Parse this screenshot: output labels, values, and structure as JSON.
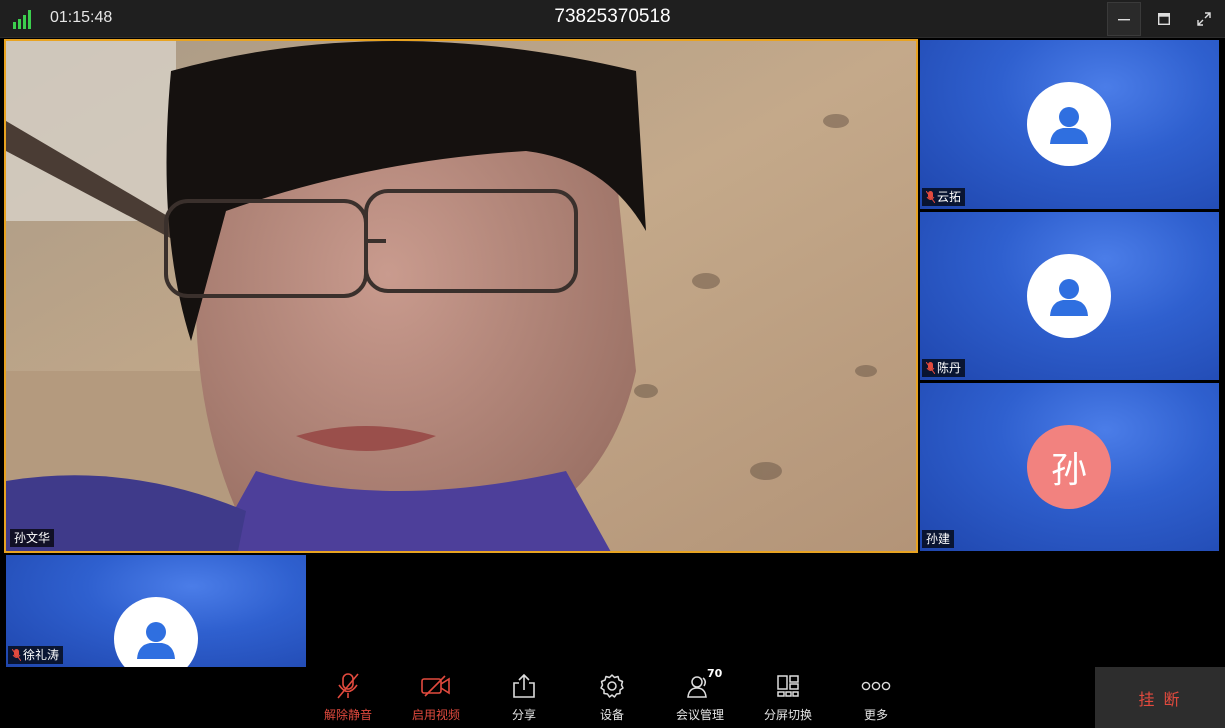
{
  "header": {
    "elapsed_time": "01:15:48",
    "meeting_id": "73825370518"
  },
  "main_video": {
    "participant_name": "孙文华"
  },
  "participants": [
    {
      "name": "云拓",
      "muted": true,
      "avatar": "person-icon"
    },
    {
      "name": "陈丹",
      "muted": true,
      "avatar": "person-icon"
    },
    {
      "name": "孙建",
      "muted": false,
      "avatar_letter": "孙"
    },
    {
      "name": "徐礼涛",
      "muted": true,
      "avatar": "person-icon"
    }
  ],
  "toolbar": {
    "unmute_label": "解除静音",
    "start_video_label": "启用视频",
    "share_label": "分享",
    "settings_label": "设备",
    "manage_label": "会议管理",
    "manage_count": "70",
    "layout_label": "分屏切换",
    "more_label": "更多",
    "hangup_label": "挂 断"
  },
  "colors": {
    "accent_border": "#e8a321",
    "danger": "#e24a3e",
    "tile_blue": "#2f60cf",
    "avatar_letter_bg": "#f2827f"
  }
}
